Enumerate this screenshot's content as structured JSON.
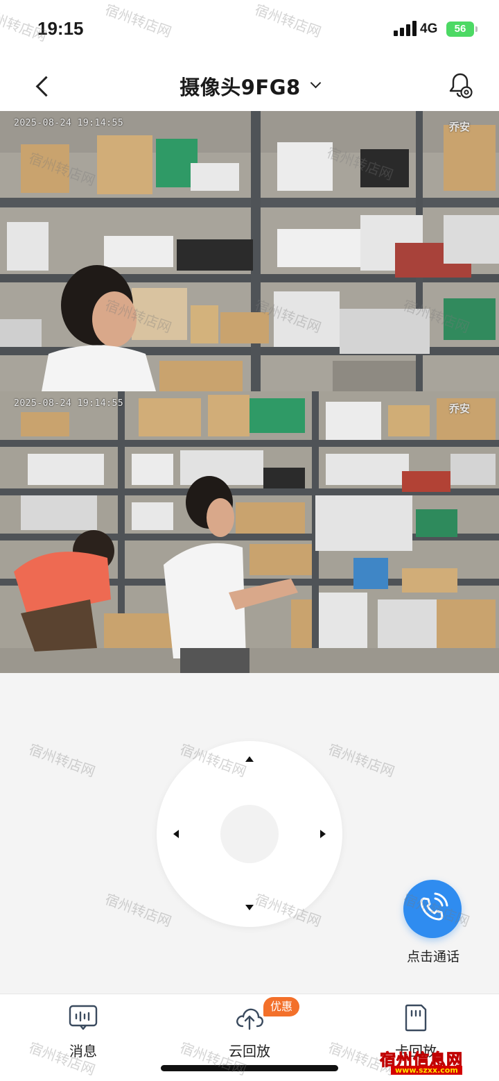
{
  "status_bar": {
    "time": "19:15",
    "network": "4G",
    "battery": "56"
  },
  "header": {
    "title": "摄像头9FG8"
  },
  "video": {
    "timestamp_top": "2025-08-24 19:14:55",
    "timestamp_bottom": "2025-08-24 19:14:55",
    "brand": "乔安"
  },
  "call": {
    "label": "点击通话"
  },
  "tabs": [
    {
      "label": "消息",
      "icon": "message-chart-icon"
    },
    {
      "label": "云回放",
      "icon": "cloud-upload-icon",
      "badge": "优惠"
    },
    {
      "label": "卡回放",
      "icon": "sd-card-icon"
    }
  ],
  "watermark": {
    "text": "宿州转店网",
    "logo_text": "宿州信息网",
    "logo_url": "www.szxx.com"
  },
  "colors": {
    "accent": "#2f8cf0",
    "promo": "#f3702a",
    "background": "#f4f4f4"
  }
}
